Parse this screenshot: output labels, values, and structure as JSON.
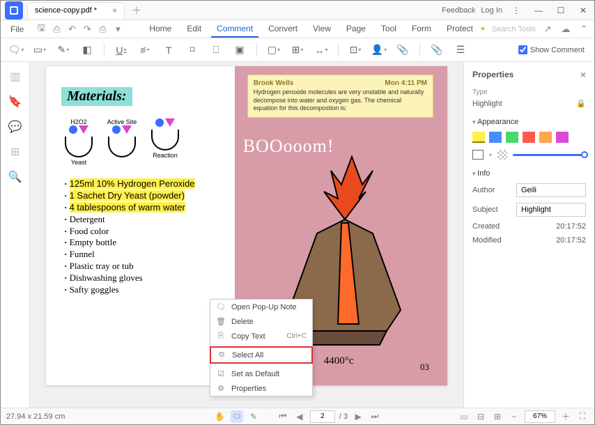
{
  "titlebar": {
    "tab_name": "science-copy.pdf *",
    "feedback": "Feedback",
    "login": "Log In"
  },
  "menu": {
    "file": "File",
    "tabs": [
      "Home",
      "Edit",
      "Comment",
      "Convert",
      "View",
      "Page",
      "Tool",
      "Form",
      "Protect"
    ],
    "active_index": 2,
    "search_placeholder": "Search Tools"
  },
  "toolbar": {
    "show_comment": "Show Comment"
  },
  "page": {
    "materials_title": "Materials:",
    "diagram_labels": [
      "H2O2",
      "Active Site",
      ""
    ],
    "diagram_sub": [
      "Yeast",
      "",
      "Reaction"
    ],
    "highlights": [
      "125ml 10% Hydrogen Peroxide",
      "1 Sachet Dry Yeast (powder)",
      "4 tablespoons of warm water"
    ],
    "bullets": [
      "Detergent",
      "Food color",
      "Empty bottle",
      "Funnel",
      "Plastic tray or tub",
      "Dishwashing gloves",
      "Safty goggles"
    ],
    "note_author": "Brook Wells",
    "note_time": "Mon 4:11 PM",
    "note_body": "Hydrogen peroxide molecules are very unstable and naturally decompose into water and oxygen gas. The chemical equation for this decompostion is:",
    "boom": "BOOooom!",
    "temp": "4400°c",
    "page_num": "03"
  },
  "context_menu": {
    "items": [
      {
        "label": "Open Pop-Up Note",
        "icon": "🗨"
      },
      {
        "label": "Delete",
        "icon": "🗑"
      },
      {
        "label": "Copy Text",
        "icon": "⎘",
        "shortcut": "Ctrl+C"
      },
      {
        "label": "Select All",
        "icon": "⧉",
        "highlight": true
      },
      {
        "label": "Set as Default",
        "icon": "☑"
      },
      {
        "label": "Properties",
        "icon": "⚙"
      }
    ]
  },
  "panel": {
    "title": "Properties",
    "type_label": "Type",
    "type_value": "Highlight",
    "appearance": "Appearance",
    "info": "Info",
    "author_label": "Author",
    "author_value": "Geili",
    "subject_label": "Subject",
    "subject_value": "Highlight",
    "created_label": "Created",
    "created_value": "20:17:52",
    "modified_label": "Modified",
    "modified_value": "20:17:52",
    "colors": [
      "#fff04a",
      "#4a8cff",
      "#4ad86a",
      "#ff5a4a",
      "#ffa64a",
      "#d84ad8"
    ]
  },
  "status": {
    "dimensions": "27.94 x 21.59 cm",
    "page_current": "2",
    "page_total": "/ 3",
    "zoom": "67%"
  }
}
